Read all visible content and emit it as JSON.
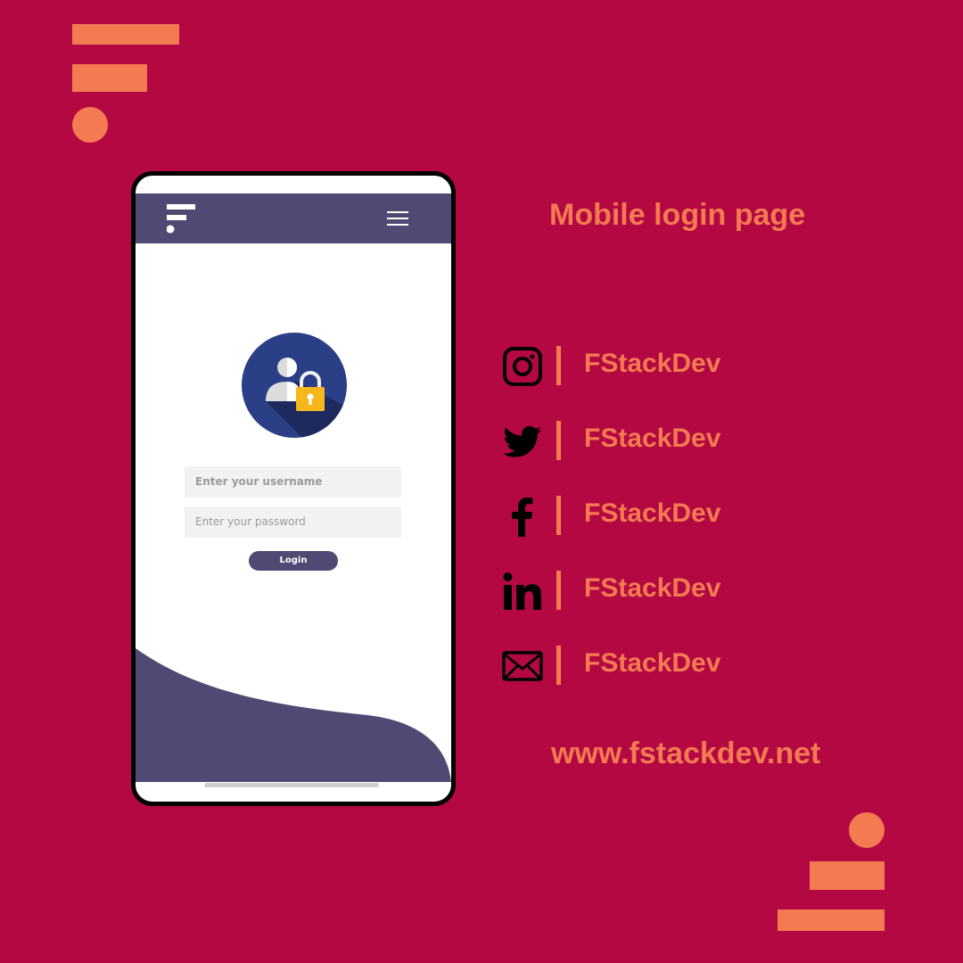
{
  "brand": {
    "accent": "#f47a52",
    "background": "#b30842",
    "header": "#4f4a74"
  },
  "phone": {
    "header": {
      "logo_icon": "fstackdev-logo-icon",
      "menu_icon": "hamburger-menu-icon"
    },
    "avatar_icon": "user-lock-icon",
    "form": {
      "username_placeholder": "Enter your username",
      "password_placeholder": "Enter your password",
      "login_label": "Login"
    }
  },
  "panel": {
    "title": "Mobile login page",
    "socials": [
      {
        "icon": "instagram-icon",
        "handle": "FStackDev"
      },
      {
        "icon": "twitter-icon",
        "handle": "FStackDev"
      },
      {
        "icon": "facebook-icon",
        "handle": "FStackDev"
      },
      {
        "icon": "linkedin-icon",
        "handle": "FStackDev"
      },
      {
        "icon": "email-icon",
        "handle": "FStackDev"
      }
    ],
    "website": "www.fstackdev.net"
  }
}
